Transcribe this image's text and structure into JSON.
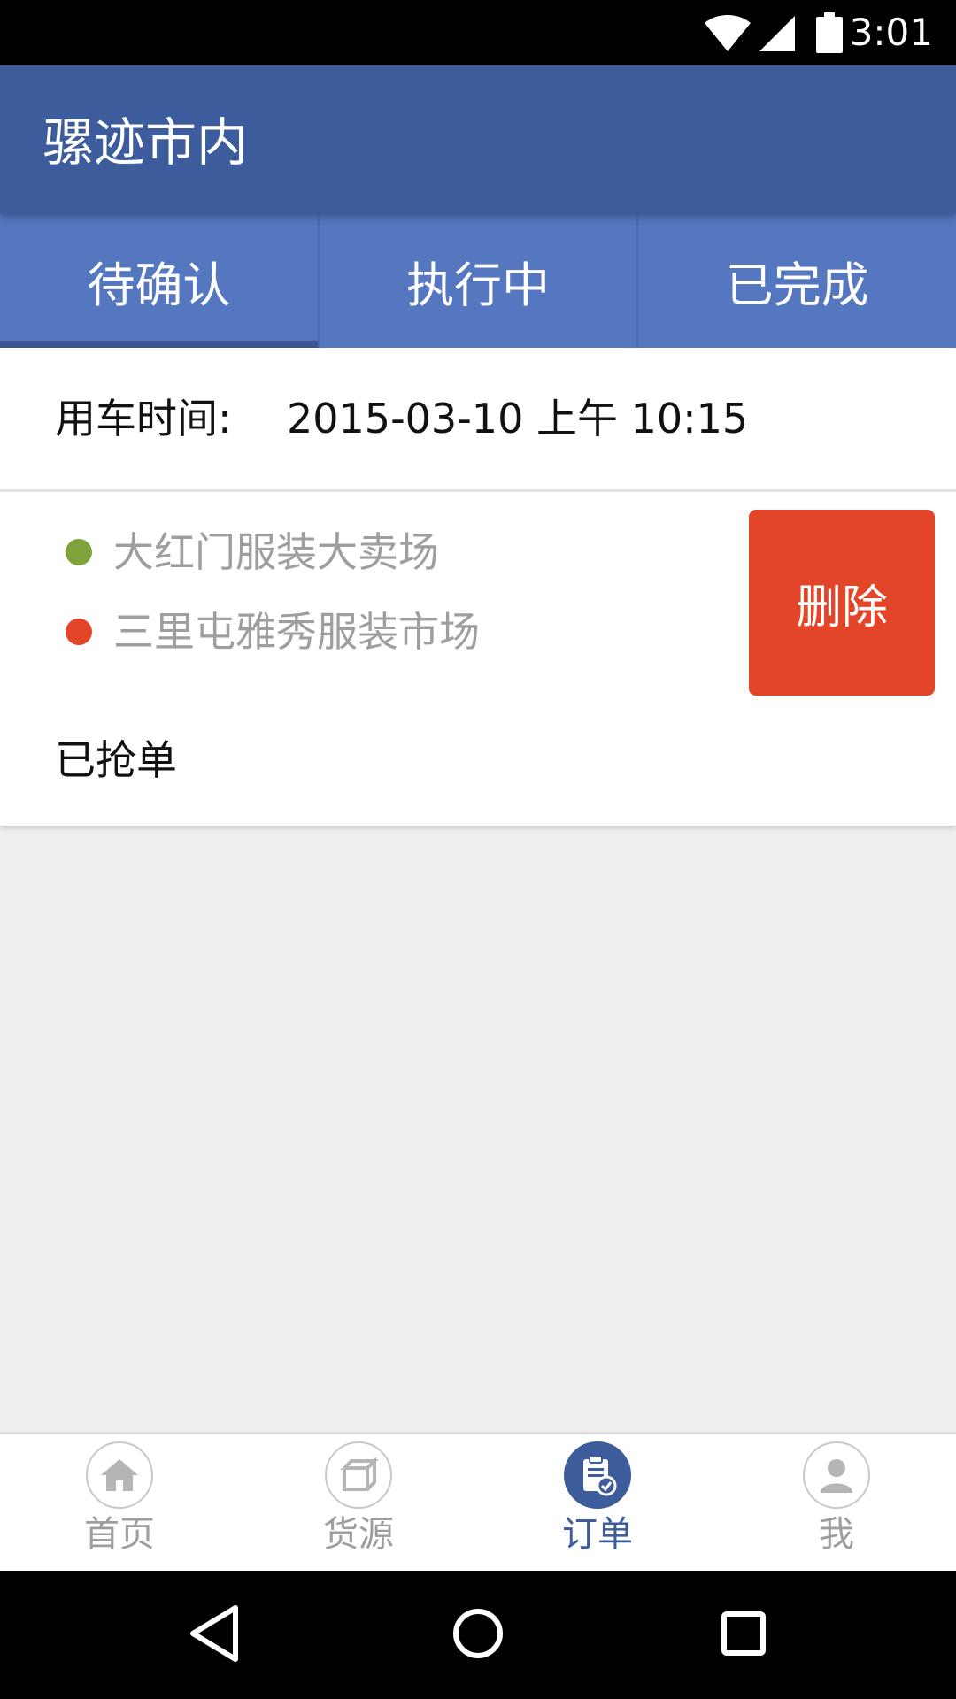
{
  "status_bar": {
    "time": "3:01"
  },
  "app_bar": {
    "title": "骡迹市内"
  },
  "tabs": [
    {
      "label": "待确认",
      "active": true
    },
    {
      "label": "执行中",
      "active": false
    },
    {
      "label": "已完成",
      "active": false
    }
  ],
  "order": {
    "time_label": "用车时间:",
    "time_value": "2015-03-10 上午 10:15",
    "from_address": "大红门服装大卖场",
    "to_address": "三里屯雅秀服装市场",
    "delete_label": "删除",
    "status": "已抢单"
  },
  "bottom_nav": [
    {
      "label": "首页",
      "icon": "home-icon",
      "active": false
    },
    {
      "label": "货源",
      "icon": "box-icon",
      "active": false
    },
    {
      "label": "订单",
      "icon": "clipboard-check-icon",
      "active": true
    },
    {
      "label": "我",
      "icon": "person-icon",
      "active": false
    }
  ],
  "colors": {
    "primary": "#3d5c9c",
    "tab_bar": "#5577c0",
    "delete": "#e34528",
    "dot_from": "#7ea33a",
    "dot_to": "#e34528"
  }
}
